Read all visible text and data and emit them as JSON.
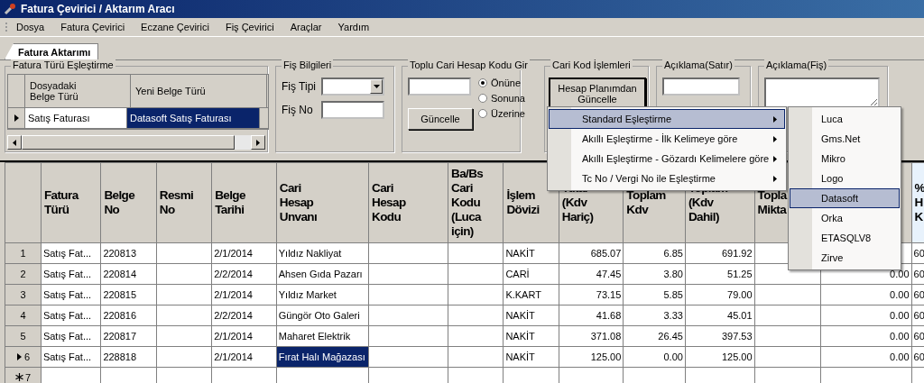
{
  "window": {
    "title": "Fatura Çevirici / Aktarım Aracı"
  },
  "menu_bar": [
    {
      "label": "Dosya"
    },
    {
      "label": "Fatura Çevirici"
    },
    {
      "label": "Eczane Çevirici"
    },
    {
      "label": "Fiş Çevirici"
    },
    {
      "label": "Araçlar"
    },
    {
      "label": "Yardım"
    }
  ],
  "tabs": [
    {
      "label": "Fatura Aktarımı",
      "selected": true
    }
  ],
  "invoice_type_mapping": {
    "title": "Fatura Türü Eşleştirme",
    "columns": [
      "Dosyadaki\nBelge Türü",
      "Yeni Belge Türü"
    ],
    "rows": [
      {
        "current": true,
        "cells": [
          {
            "text": "Satış Faturası",
            "selected": false
          },
          {
            "text": "Datasoft Satış Faturası",
            "selected": true
          }
        ]
      }
    ]
  },
  "receipt_info": {
    "title": "Fiş Bilgileri",
    "fields": [
      {
        "label": "Fiş Tipi",
        "kind": "dropdown"
      },
      {
        "label": "Fiş No",
        "kind": "text"
      }
    ]
  },
  "bulk_account_code": {
    "title": "Toplu Cari Hesap Kodu Gir",
    "button": "Güncelle",
    "options": [
      {
        "label": "Önüne",
        "selected": true
      },
      {
        "label": "Sonuna",
        "selected": false
      },
      {
        "label": "Üzerine",
        "selected": false
      }
    ]
  },
  "account_code_operations": {
    "title": "Cari Kod İşlemleri",
    "button": "Hesap Planımdan Güncelle"
  },
  "line_description": {
    "title": "Açıklama(Satır)"
  },
  "receipt_description": {
    "title": "Açıklama(Fiş)"
  },
  "table": {
    "columns": [
      "Fatura\nTürü",
      "Belge\nNo",
      "Resmi\nNo",
      "Belge\nTarihi",
      "Cari\nHesap\nUnvanı",
      "Cari\nHesap\nKodu",
      "Ba/Bs\nCari\nKodu\n(Luca\niçin)",
      "İşlem\nDövizi",
      "Tutar\n(Kdv\nHariç)",
      "Toplam\nKdv",
      "Toplam\n(Kdv\nDahil)",
      "Topla\nMikta",
      "",
      "%\nH\nK"
    ],
    "rows": [
      {
        "number": "1",
        "current": false,
        "new_row": false,
        "cells": [
          "Satış Fat...",
          "220813",
          "",
          "2/1/2014",
          "Yıldız Nakliyat",
          "",
          "",
          "NAKİT",
          "685.07",
          "6.85",
          "691.92",
          "",
          "",
          "60"
        ]
      },
      {
        "number": "2",
        "current": false,
        "new_row": false,
        "cells": [
          "Satış Fat...",
          "220814",
          "",
          "2/2/2014",
          "Ahsen Gıda Pazarı",
          "",
          "",
          "CARİ",
          "47.45",
          "3.80",
          "51.25",
          "",
          "0.00",
          "60"
        ]
      },
      {
        "number": "3",
        "current": false,
        "new_row": false,
        "cells": [
          "Satış Fat...",
          "220815",
          "",
          "2/1/2014",
          "Yıldız Market",
          "",
          "",
          "K.KART",
          "73.15",
          "5.85",
          "79.00",
          "",
          "0.00",
          "60"
        ]
      },
      {
        "number": "4",
        "current": false,
        "new_row": false,
        "cells": [
          "Satış Fat...",
          "220816",
          "",
          "2/2/2014",
          "Güngör Oto Galeri",
          "",
          "",
          "NAKİT",
          "41.68",
          "3.33",
          "45.01",
          "",
          "0.00",
          "60"
        ]
      },
      {
        "number": "5",
        "current": false,
        "new_row": false,
        "cells": [
          "Satış Fat...",
          "220817",
          "",
          "2/1/2014",
          "Maharet Elektrik",
          "",
          "",
          "NAKİT",
          "371.08",
          "26.45",
          "397.53",
          "",
          "0.00",
          "60"
        ]
      },
      {
        "number": "6",
        "current": true,
        "new_row": false,
        "cells": [
          "Satış Fat...",
          "228818",
          "",
          "2/1/2014",
          {
            "text": "Fırat Halı Mağazası",
            "selected": true
          },
          "",
          "",
          "NAKİT",
          "125.00",
          "0.00",
          "125.00",
          "",
          "0.00",
          "60"
        ]
      },
      {
        "number": "7",
        "current": false,
        "new_row": true,
        "cells": [
          "",
          "",
          "",
          "",
          "",
          "",
          "",
          "",
          "",
          "",
          "",
          "",
          "",
          ""
        ]
      }
    ]
  },
  "context_menu": {
    "items": [
      {
        "label": "Standard Eşleştirme",
        "highlighted": true,
        "has_submenu": true
      },
      {
        "label": "Akıllı Eşleştirme - İlk Kelimeye göre",
        "highlighted": false,
        "has_submenu": true
      },
      {
        "label": "Akıllı Eşleştirme - Gözardı Kelimelere göre",
        "highlighted": false,
        "has_submenu": true
      },
      {
        "label": "Tc No / Vergi No ile Eşleştirme",
        "highlighted": false,
        "has_submenu": true
      }
    ],
    "submenu": {
      "items": [
        {
          "label": "Luca",
          "highlighted": false
        },
        {
          "label": "Gms.Net",
          "highlighted": false
        },
        {
          "label": "Mikro",
          "highlighted": false
        },
        {
          "label": "Logo",
          "highlighted": false
        },
        {
          "label": "Datasoft",
          "highlighted": true
        },
        {
          "label": "Orka",
          "highlighted": false
        },
        {
          "label": "ETASQLV8",
          "highlighted": false
        },
        {
          "label": "Zirve",
          "highlighted": false
        }
      ]
    }
  }
}
